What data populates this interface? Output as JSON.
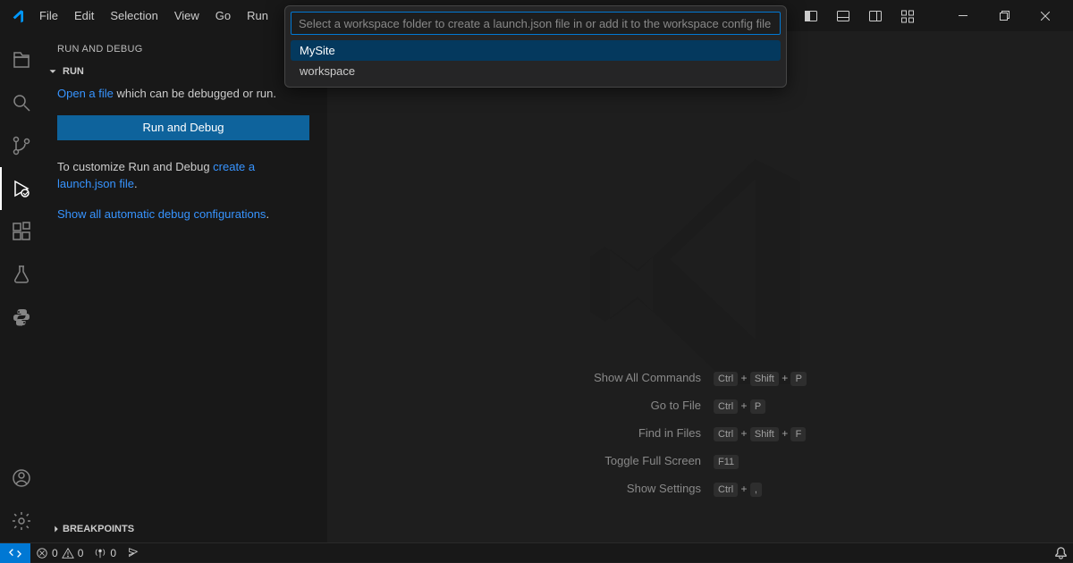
{
  "menubar": {
    "file": "File",
    "edit": "Edit",
    "selection": "Selection",
    "view": "View",
    "go": "Go",
    "run": "Run"
  },
  "sidebar": {
    "title": "RUN AND DEBUG",
    "section": "RUN",
    "openFilePrefix": "Open a file",
    "openFileSuffix": " which can be debugged or run.",
    "runButton": "Run and Debug",
    "customizePrefix": "To customize Run and Debug ",
    "customizeLink": "create a launch.json file",
    "customizeSuffix": ".",
    "showAll": "Show all automatic debug configurations",
    "showAllDot": ".",
    "breakpoints": "BREAKPOINTS"
  },
  "quickinput": {
    "placeholder": "Select a workspace folder to create a launch.json file in or add it to the workspace config file",
    "items": [
      "MySite",
      "workspace"
    ]
  },
  "hints": {
    "showAllCommands": {
      "label": "Show All Commands",
      "keys": [
        "Ctrl",
        "+",
        "Shift",
        "+",
        "P"
      ]
    },
    "goToFile": {
      "label": "Go to File",
      "keys": [
        "Ctrl",
        "+",
        "P"
      ]
    },
    "findInFiles": {
      "label": "Find in Files",
      "keys": [
        "Ctrl",
        "+",
        "Shift",
        "+",
        "F"
      ]
    },
    "toggleFullScreen": {
      "label": "Toggle Full Screen",
      "keys": [
        "F11"
      ]
    },
    "showSettings": {
      "label": "Show Settings",
      "keys": [
        "Ctrl",
        "+",
        ","
      ]
    }
  },
  "status": {
    "errors": "0",
    "warnings": "0",
    "ports": "0"
  }
}
